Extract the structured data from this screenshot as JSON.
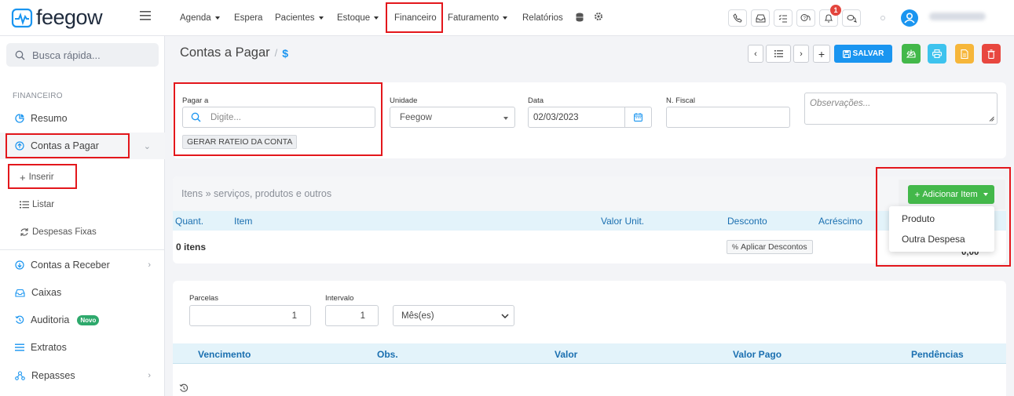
{
  "brand": {
    "name": "feegow",
    "color": "#1a95f0"
  },
  "nav": [
    {
      "label": "Agenda",
      "dropdown": true
    },
    {
      "label": "Espera",
      "dropdown": false
    },
    {
      "label": "Pacientes",
      "dropdown": true
    },
    {
      "label": "Estoque",
      "dropdown": true
    },
    {
      "label": "Financeiro",
      "dropdown": false,
      "highlighted": true
    },
    {
      "label": "Faturamento",
      "dropdown": true
    },
    {
      "label": "Relatórios",
      "dropdown": false
    }
  ],
  "notifications_count": "1",
  "search": {
    "placeholder": "Busca rápida..."
  },
  "sidebar": {
    "section": "FINANCEIRO",
    "items": [
      {
        "label": "Resumo",
        "icon": "chart-pie-icon"
      },
      {
        "label": "Contas a Pagar",
        "icon": "arrow-up-circle-icon",
        "expanded": true
      },
      {
        "label": "Contas a Receber",
        "icon": "arrow-down-circle-icon"
      },
      {
        "label": "Caixas",
        "icon": "inbox-icon"
      },
      {
        "label": "Auditoria",
        "icon": "history-icon",
        "badge": "Novo"
      },
      {
        "label": "Extratos",
        "icon": "list-icon"
      },
      {
        "label": "Repasses",
        "icon": "share-icon"
      }
    ],
    "subitems": [
      {
        "label": "Inserir",
        "icon": "plus-icon"
      },
      {
        "label": "Listar",
        "icon": "list-icon"
      },
      {
        "label": "Despesas Fixas",
        "icon": "refresh-icon"
      }
    ]
  },
  "page": {
    "title": "Contas a Pagar",
    "separator": "/",
    "title_icon": "$",
    "save_label": "SALVAR"
  },
  "form": {
    "pagar_a": {
      "label": "Pagar a",
      "placeholder": "Digite..."
    },
    "rateio_button": "GERAR RATEIO DA CONTA",
    "unidade": {
      "label": "Unidade",
      "value": "Feegow"
    },
    "data": {
      "label": "Data",
      "value": "02/03/2023"
    },
    "nfiscal": {
      "label": "N. Fiscal",
      "value": ""
    },
    "observacoes": {
      "placeholder": "Observações..."
    }
  },
  "items_section": {
    "title": "Itens » serviços, produtos e outros",
    "add_button": "Adicionar Item",
    "columns": [
      "Quant.",
      "Item",
      "Valor Unit.",
      "Desconto",
      "Acréscimo"
    ],
    "count": "0 itens",
    "apply_discounts": "Aplicar Descontos",
    "total": "0,00",
    "dropdown_options": [
      "Produto",
      "Outra Despesa"
    ]
  },
  "installments": {
    "parcelas_label": "Parcelas",
    "parcelas_value": "1",
    "intervalo_label": "Intervalo",
    "intervalo_value": "1",
    "period_value": "Mês(es)",
    "columns": [
      "Vencimento",
      "Obs.",
      "Valor",
      "Valor Pago",
      "Pendências"
    ]
  },
  "colors": {
    "accent": "#1a95f0",
    "highlight_box": "#e3171c",
    "success": "#43b84a",
    "info": "#3dc3ee",
    "warning": "#f6b63a",
    "danger": "#e8473f",
    "table_header_bg": "#e3f3fa"
  }
}
